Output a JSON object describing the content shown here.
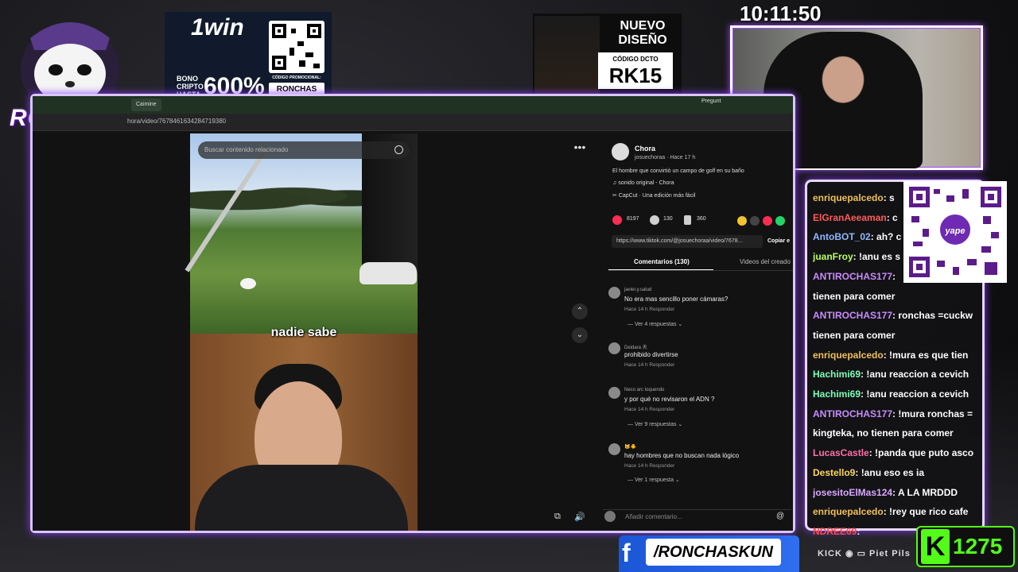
{
  "overlay": {
    "logo_text": "RONCHAS",
    "clock": "10:11:50",
    "win_banner": {
      "brand": "1win",
      "bonus_text": "BONO CRIPTO HASTA",
      "bonus_value": "600%",
      "promo_label": "CÓDIGO PROMOCIONAL:",
      "promo_code": "RONCHAS"
    },
    "design_banner": {
      "title": "NUEVO DISEÑO",
      "sub": "CÓDIGO DCTO",
      "code": "RK15"
    },
    "facebook_handle": "/RONCHASKUN",
    "social_row": "KICK ◉ ▭ Piet Pils",
    "kick_viewers": "1275",
    "yape_label": "yape"
  },
  "browser": {
    "tab1": "Caimine",
    "tab_ask": "Pregunt",
    "url": "hora/video/7678461634284719380"
  },
  "video": {
    "search_placeholder": "Buscar contenido relacionado",
    "caption": "nadie sabe"
  },
  "post": {
    "author": "Chora",
    "meta": "josuechoraa · Hace 17 h",
    "description": "El hombre que convirtió un campo de golf en su baño",
    "sound": "sonido original - Chora",
    "capcut": "CapCut · Una edición más fácil",
    "likes": "8197",
    "comments_count": "130",
    "saves": "360",
    "link": "https://www.tiktok.com/@josuechoraa/video/7678...",
    "copy_label": "Copiar e",
    "tab_comments": "Comentarios (130)",
    "tab_videos": "Videos del creado",
    "comment_placeholder": "Añadir comentario..."
  },
  "comments": [
    {
      "user": "javier.y.salud",
      "text": "No era mas sencillo poner cámaras?",
      "meta": "Hace 14 h    Responder",
      "replies": "— Ver 4 respuestas ⌄"
    },
    {
      "user": "Deidara 天",
      "text": "prohibido divertirse",
      "meta": "Hace 14 h    Responder",
      "replies": ""
    },
    {
      "user": "Neco arc loquendo",
      "text": "y por qué no revisaron el ADN ?",
      "meta": "Hace 14 h    Responder",
      "replies": "— Ver 9 respuestas ⌄"
    },
    {
      "user": "🐱🐥",
      "text": "hay hombres que no buscan nada lógico",
      "meta": "Hace 14 h    Responder",
      "replies": "— Ver 1 respuesta ⌄"
    }
  ],
  "chat": [
    {
      "user": "enriquepalcedo",
      "color": "#f0c05a",
      "text": ": s"
    },
    {
      "user": "ElGranAeeaman",
      "color": "#ff5b5b",
      "text": ": c"
    },
    {
      "user": "AntoBOT_02",
      "color": "#8fb8ff",
      "text": ": ah? c"
    },
    {
      "user": "juanFroy",
      "color": "#b8ff5b",
      "text": ": !anu es s"
    },
    {
      "user": "ANTIROCHAS177",
      "color": "#c98bff",
      "text": ":"
    },
    {
      "user": "",
      "color": "#fff",
      "text": "tienen para comer"
    },
    {
      "user": "ANTIROCHAS177",
      "color": "#c98bff",
      "text": ": ronchas =cuckw"
    },
    {
      "user": "",
      "color": "#fff",
      "text": "tienen para comer"
    },
    {
      "user": "enriquepalcedo",
      "color": "#f0c05a",
      "text": ": !mura es que tien"
    },
    {
      "user": "Hachimi69",
      "color": "#7dffb6",
      "text": ": !anu reaccion a cevich"
    },
    {
      "user": "Hachimi69",
      "color": "#7dffb6",
      "text": ": !anu reaccion a cevich"
    },
    {
      "user": "ANTIROCHAS177",
      "color": "#c98bff",
      "text": ": !mura ronchas ="
    },
    {
      "user": "",
      "color": "#fff",
      "text": "kingteka, no tienen para comer"
    },
    {
      "user": "LucasCastle",
      "color": "#ff6fa8",
      "text": ": !panda que puto asco"
    },
    {
      "user": "Destello9",
      "color": "#ffd75b",
      "text": ": !anu eso es ia"
    },
    {
      "user": "josesitoElMas124",
      "color": "#d9a8ff",
      "text": ": A LA MRDDD"
    },
    {
      "user": "enriquepalcedo",
      "color": "#f0c05a",
      "text": ": !rey que rico cafe"
    },
    {
      "user": "NDREE69",
      "color": "#ff4b4b",
      "text": ":"
    }
  ]
}
